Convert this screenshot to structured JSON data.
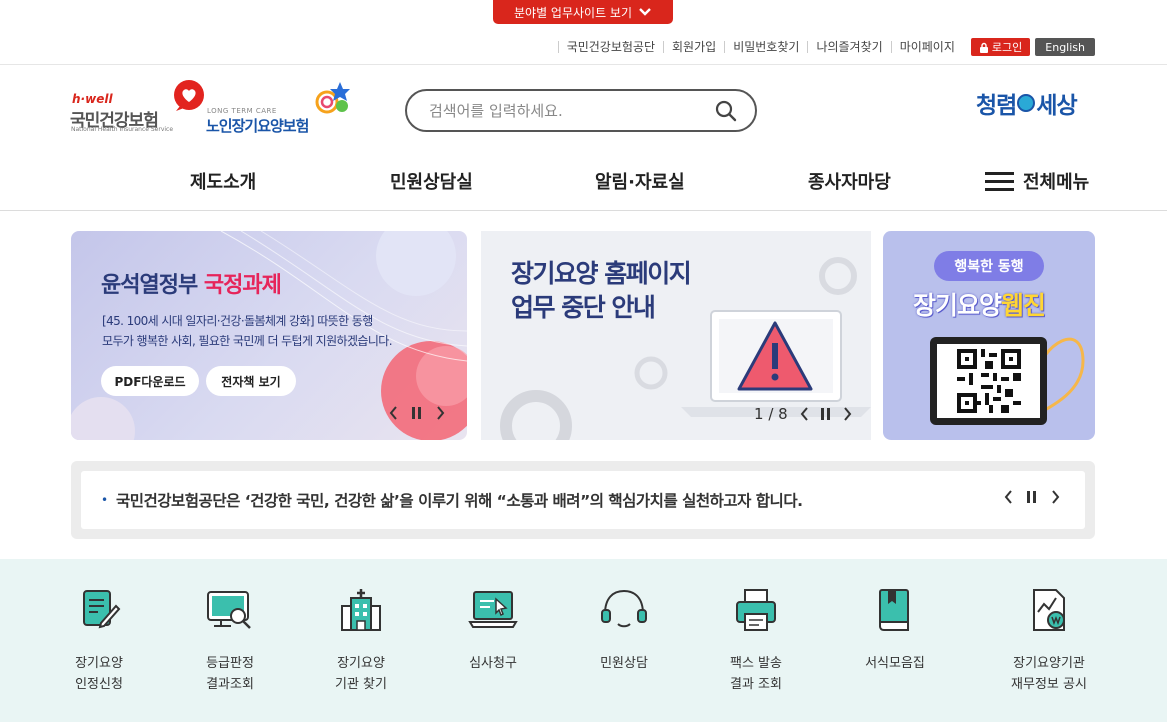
{
  "top": {
    "site_toggle": "분야별 업무사이트 보기",
    "util_links": [
      "국민건강보험공단",
      "회원가입",
      "비밀번호찾기",
      "나의즐겨찾기",
      "마이페이지"
    ],
    "login": "로그인",
    "english": "English"
  },
  "logos": {
    "nhis_tag": "h·well",
    "nhis_name": "국민건강보험",
    "nhis_sub": "National Health Insurance Service",
    "ltc_tag": "LONG TERM CARE",
    "ltc_name": "노인장기요양보험",
    "clean_left": "청렴",
    "clean_right": "세상"
  },
  "search": {
    "placeholder": "검색어를 입력하세요.",
    "value": ""
  },
  "gnb": {
    "items": [
      "제도소개",
      "민원상담실",
      "알림·자료실",
      "종사자마당"
    ],
    "all_menu": "전체메뉴"
  },
  "banners": {
    "b1": {
      "title_prefix": "윤석열정부",
      "title_highlight": "국정과제",
      "desc1": "[45. 100세 시대 일자리·건강·돌봄체계 강화] 따뜻한 동행",
      "desc2": "모두가 행복한 사회, 필요한 국민께 더 두텁게 지원하겠습니다.",
      "btn_pdf": "PDF다운로드",
      "btn_ebook": "전자책 보기"
    },
    "b2": {
      "title1": "장기요양 홈페이지",
      "title2": "업무 중단 안내",
      "page_current": "1",
      "page_sep": "/",
      "page_total": "8"
    },
    "b3": {
      "pill": "행복한 동행",
      "title": "장기요양",
      "title_highlight": "웹진"
    }
  },
  "notice": {
    "text": "국민건강보험공단은 ‘건강한 국민, 건강한 삶’을 이루기 위해 “소통과 배려”의 핵심가치를 실천하고자 합니다."
  },
  "quick": [
    {
      "line1": "장기요양",
      "line2": "인정신청",
      "icon": "application-edit-icon"
    },
    {
      "line1": "등급판정",
      "line2": "결과조회",
      "icon": "monitor-search-icon"
    },
    {
      "line1": "장기요양",
      "line2": "기관 찾기",
      "icon": "hospital-building-icon"
    },
    {
      "line1": "심사청구",
      "line2": "",
      "icon": "laptop-cursor-icon"
    },
    {
      "line1": "민원상담",
      "line2": "",
      "icon": "headset-icon"
    },
    {
      "line1": "팩스 발송",
      "line2": "결과 조회",
      "icon": "fax-printer-icon"
    },
    {
      "line1": "서식모음집",
      "line2": "",
      "icon": "book-icon"
    },
    {
      "line1": "장기요양기관",
      "line2": "재무정보 공시",
      "icon": "finance-document-icon"
    }
  ],
  "colors": {
    "accent_red": "#d9261c",
    "brand_blue": "#1a55a8",
    "quick_bg": "#e9f5f4",
    "icon_teal": "#3bbfad"
  }
}
